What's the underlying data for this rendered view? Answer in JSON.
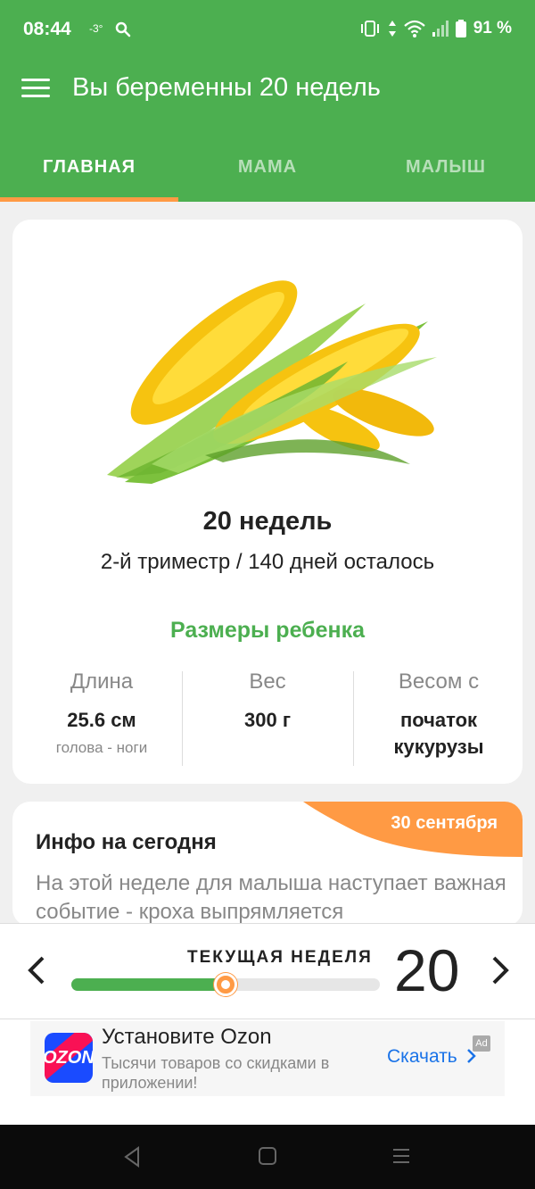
{
  "status_bar": {
    "time": "08:44",
    "temperature": "-3°",
    "battery": "91 %",
    "icons": [
      "search-icon",
      "vibrate-icon",
      "data-arrows-icon",
      "wifi-icon",
      "signal-icon",
      "battery-icon"
    ]
  },
  "toolbar": {
    "title": "Вы беременны 20 недель",
    "menu_icon": "hamburger-menu-icon"
  },
  "tabs": [
    {
      "label": "ГЛАВНАЯ",
      "active": true
    },
    {
      "label": "МАМА",
      "active": false
    },
    {
      "label": "МАЛЫШ",
      "active": false
    }
  ],
  "main_card": {
    "image": "corn-cobs",
    "weeks": "20 недель",
    "trimester": "2-й триместр / 140 дней осталось",
    "sizes_title": "Размеры ребенка",
    "length": {
      "header": "Длина",
      "value": "25.6 см",
      "note": "голова - ноги"
    },
    "weight": {
      "header": "Вес",
      "value": "300 г"
    },
    "compare": {
      "header": "Весом с",
      "value": "початок кукурузы"
    }
  },
  "info_card": {
    "date": "30 сентября",
    "title": "Инфо на сегодня",
    "text": "На этой неделе для малыша наступает важная событие - кроха выпрямляется"
  },
  "week_bar": {
    "label": "ТЕКУЩАЯ НЕДЕЛЯ",
    "number": "20",
    "progress": 0.5
  },
  "ad": {
    "brand": "OZON",
    "title": "Установите Ozon",
    "description": "Тысячи товаров со скидками в приложении!",
    "cta": "Скачать",
    "badge": "Ad"
  },
  "colors": {
    "primary": "#4caf50",
    "accent": "#ff9a44",
    "link": "#1a73e8"
  }
}
